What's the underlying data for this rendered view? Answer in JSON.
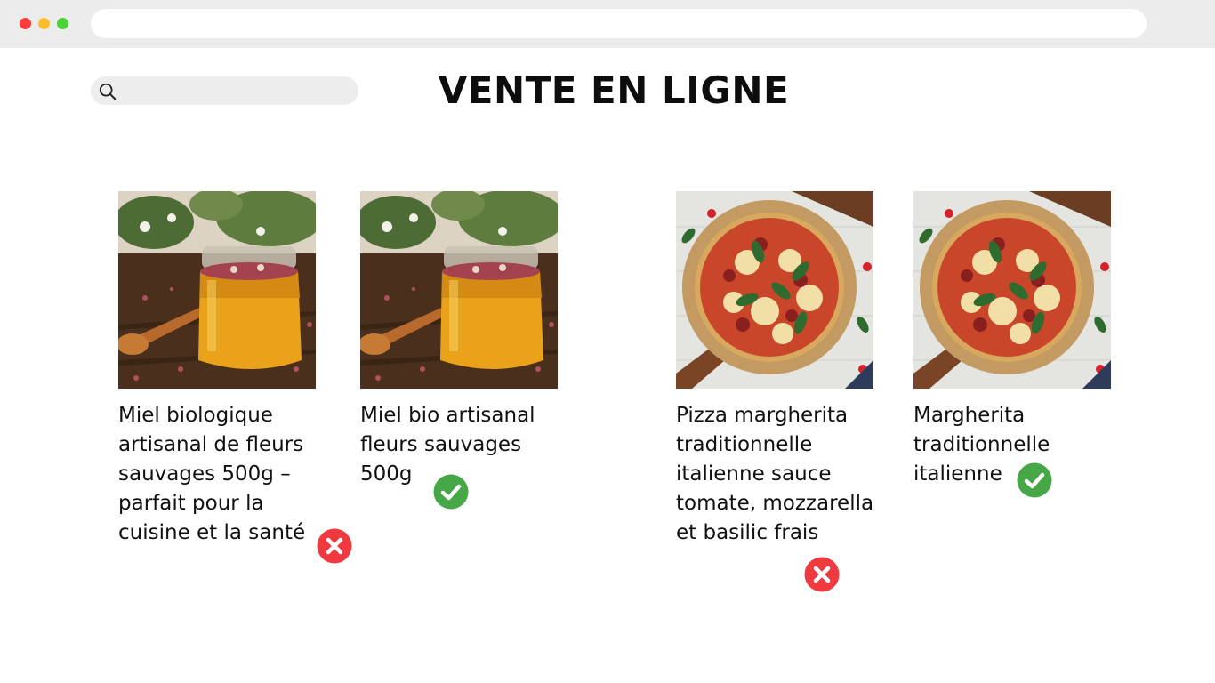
{
  "page": {
    "title": "VENTE EN LIGNE",
    "search": {
      "placeholder": "",
      "icon": "search-icon"
    }
  },
  "colors": {
    "reject": "#ef3b3f",
    "accept": "#45a745",
    "search_bg": "#ededed",
    "chrome_bg": "#ececec"
  },
  "products": [
    {
      "name": "Miel biologique artisanal de fleurs sauvages 500g – parfait pour la cuisine et la santé",
      "image": "honey-jar",
      "status": "rejected",
      "status_icon": "cross-icon"
    },
    {
      "name": "Miel bio artisanal fleurs sauvages 500g",
      "image": "honey-jar",
      "status": "accepted",
      "status_icon": "check-icon"
    },
    {
      "name": "Pizza margherita traditionnelle italienne sauce tomate, mozzarella et basilic frais",
      "image": "pizza",
      "status": "rejected",
      "status_icon": "cross-icon"
    },
    {
      "name": "Margherita traditionnelle italienne",
      "image": "pizza",
      "status": "accepted",
      "status_icon": "check-icon"
    }
  ]
}
